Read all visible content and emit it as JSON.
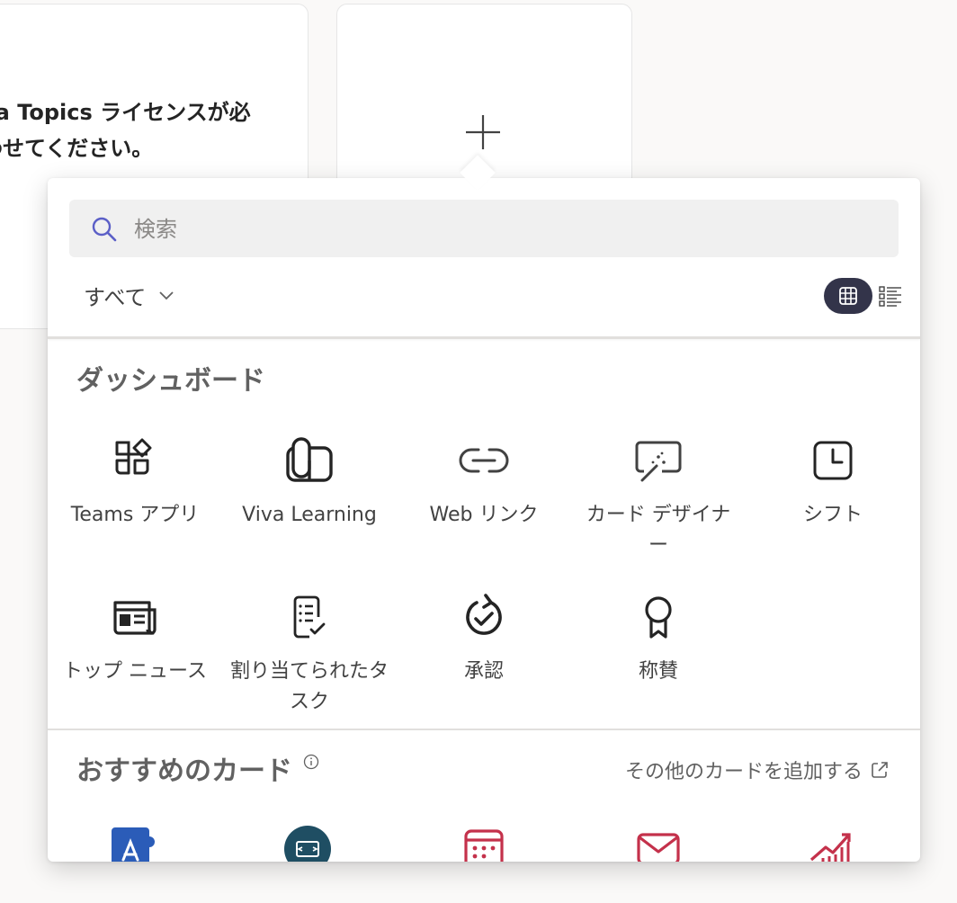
{
  "background": {
    "left_card_text": [
      "va Topics ライセンスが必",
      "わせてください。"
    ]
  },
  "picker": {
    "search": {
      "placeholder": "検索",
      "value": ""
    },
    "filter": {
      "label": "すべて"
    },
    "view_toggle": {
      "selected": "grid",
      "options": [
        "grid",
        "list"
      ]
    },
    "sections": {
      "dashboard": {
        "title": "ダッシュボード",
        "items": [
          {
            "label": "Teams アプリ",
            "icon": "apps-icon"
          },
          {
            "label": "Viva Learning",
            "icon": "viva-learning-icon"
          },
          {
            "label": "Web リンク",
            "icon": "link-icon"
          },
          {
            "label": "カード デザイナー",
            "icon": "card-designer-icon"
          },
          {
            "label": "シフト",
            "icon": "clock-icon"
          },
          {
            "label": "トップ ニュース",
            "icon": "news-icon"
          },
          {
            "label": "割り当てられたタスク",
            "icon": "task-list-icon"
          },
          {
            "label": "承認",
            "icon": "approvals-icon"
          },
          {
            "label": "称賛",
            "icon": "ribbon-icon"
          }
        ]
      },
      "recommended": {
        "title": "おすすめのカード",
        "more_link": "その他のカードを追加する",
        "items": [
          {
            "icon": "app-store-icon",
            "color": "#2b5cb8"
          },
          {
            "icon": "viva-connections-icon",
            "color": "#1f4e63"
          },
          {
            "icon": "calendar-icon",
            "color": "#c4314b"
          },
          {
            "icon": "mail-icon",
            "color": "#c4314b"
          },
          {
            "icon": "chart-growth-icon",
            "color": "#c4314b"
          }
        ]
      }
    }
  },
  "colors": {
    "accent_dark": "#33344a",
    "search_icon": "#5b5fc7",
    "recommended_red": "#c4314b"
  }
}
